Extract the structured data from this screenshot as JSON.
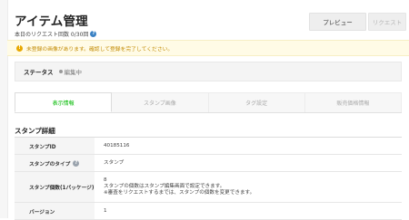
{
  "header": {
    "title": "アイテム管理",
    "request_count_text": "本日のリクエスト回数 0/30回",
    "preview_label": "プレビュー",
    "request_label": "リクエスト"
  },
  "alert": {
    "text": "未登録の画像があります。確認して登録を完了してください。"
  },
  "status": {
    "label": "ステータス",
    "value": "編集中"
  },
  "tabs": [
    {
      "label": "表示情報",
      "active": true
    },
    {
      "label": "スタンプ画像",
      "active": false
    },
    {
      "label": "タグ設定",
      "active": false
    },
    {
      "label": "販売価格情報",
      "active": false
    }
  ],
  "detail": {
    "section_title": "スタンプ詳細",
    "rows": [
      {
        "label": "スタンプID",
        "value": "40185116"
      },
      {
        "label": "スタンプのタイプ",
        "value": "スタンプ"
      },
      {
        "label": "スタンプ個数(1パッケージ)",
        "value": "8",
        "note1": "スタンプの個数はスタンプ編集画面で設定できます。",
        "note2": "※審査をリクエストするまでは、スタンプの個数を変更できます。"
      },
      {
        "label": "バージョン",
        "value": "1"
      }
    ]
  },
  "colors": {
    "accent_green": "#00b900",
    "help_blue": "#3b82c4",
    "warning": "#e8a800"
  }
}
